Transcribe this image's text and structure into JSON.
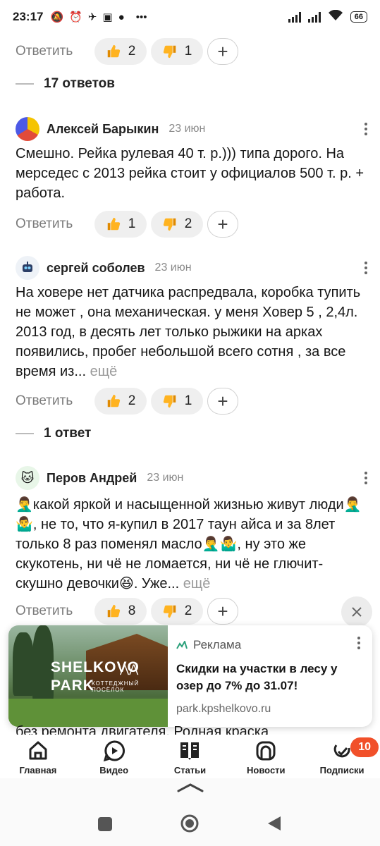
{
  "status_bar": {
    "time": "23:17",
    "battery": "66",
    "icons": [
      "mute-icon",
      "alarm-icon",
      "telegram-icon",
      "news-icon",
      "chat-icon",
      "more-icon"
    ]
  },
  "top_reactions": {
    "reply": "Ответить",
    "likes": "2",
    "dislikes": "1"
  },
  "thread1": {
    "label": "17 ответов"
  },
  "comment1": {
    "author": "Алексей Барыкин",
    "date": "23 июн",
    "text": "Смешно. Рейка рулевая 40 т. р.))) типа дорого. На мерседес с 2013 рейка стоит у официалов 500 т. р. + работа.",
    "reply": "Ответить",
    "likes": "1",
    "dislikes": "2"
  },
  "comment2": {
    "author": "сергей соболев",
    "date": "23 июн",
    "text": "На ховере нет датчика распредвала, коробка тупить не может , она механическая. у меня Ховер 5 , 2,4л. 2013 год, в десять лет только рыжики на арках появились, пробег небольшой всего сотня , за все время из...",
    "more": "ещё",
    "reply": "Ответить",
    "likes": "2",
    "dislikes": "1"
  },
  "thread2": {
    "label": "1 ответ"
  },
  "comment3": {
    "author": "Перов Андрей",
    "date": "23 июн",
    "text": "🤦‍♂️какой яркой и насыщенной жизнью живут люди🤦‍♂️🤷‍♂️, не то, что я-купил в 2017 таун айса и за 8лет только 8 раз поменял масло🤦‍♂️🤷‍♂️, ну это же скукотень, ни чё не ломается, ни чё не глючит-скушно девочки😆. Уже...",
    "more": "ещё",
    "reply": "Ответить",
    "likes": "8",
    "dislikes": "2"
  },
  "ad": {
    "label": "Реклама",
    "title": "Скидки на участки в лесу у озер до 7% до 31.07!",
    "url": "park.kpshelkovo.ru",
    "logo_line1": "SHELKOVO",
    "logo_line2": "PARK",
    "logo_sub": "КОТТЕДЖНЫЙ ПОСЁЛОК"
  },
  "peek_text": "без ремонта двигателя. Родная краска",
  "nav": {
    "items": [
      {
        "label": "Главная",
        "icon": "home-icon"
      },
      {
        "label": "Видео",
        "icon": "video-icon"
      },
      {
        "label": "Статьи",
        "icon": "articles-icon"
      },
      {
        "label": "Новости",
        "icon": "news-icon"
      },
      {
        "label": "Подписки",
        "icon": "subscriptions-icon",
        "badge": "10"
      }
    ]
  },
  "colors": {
    "accent": "#f1502a",
    "pill_bg": "#efefef",
    "muted": "#7b7b7b"
  }
}
